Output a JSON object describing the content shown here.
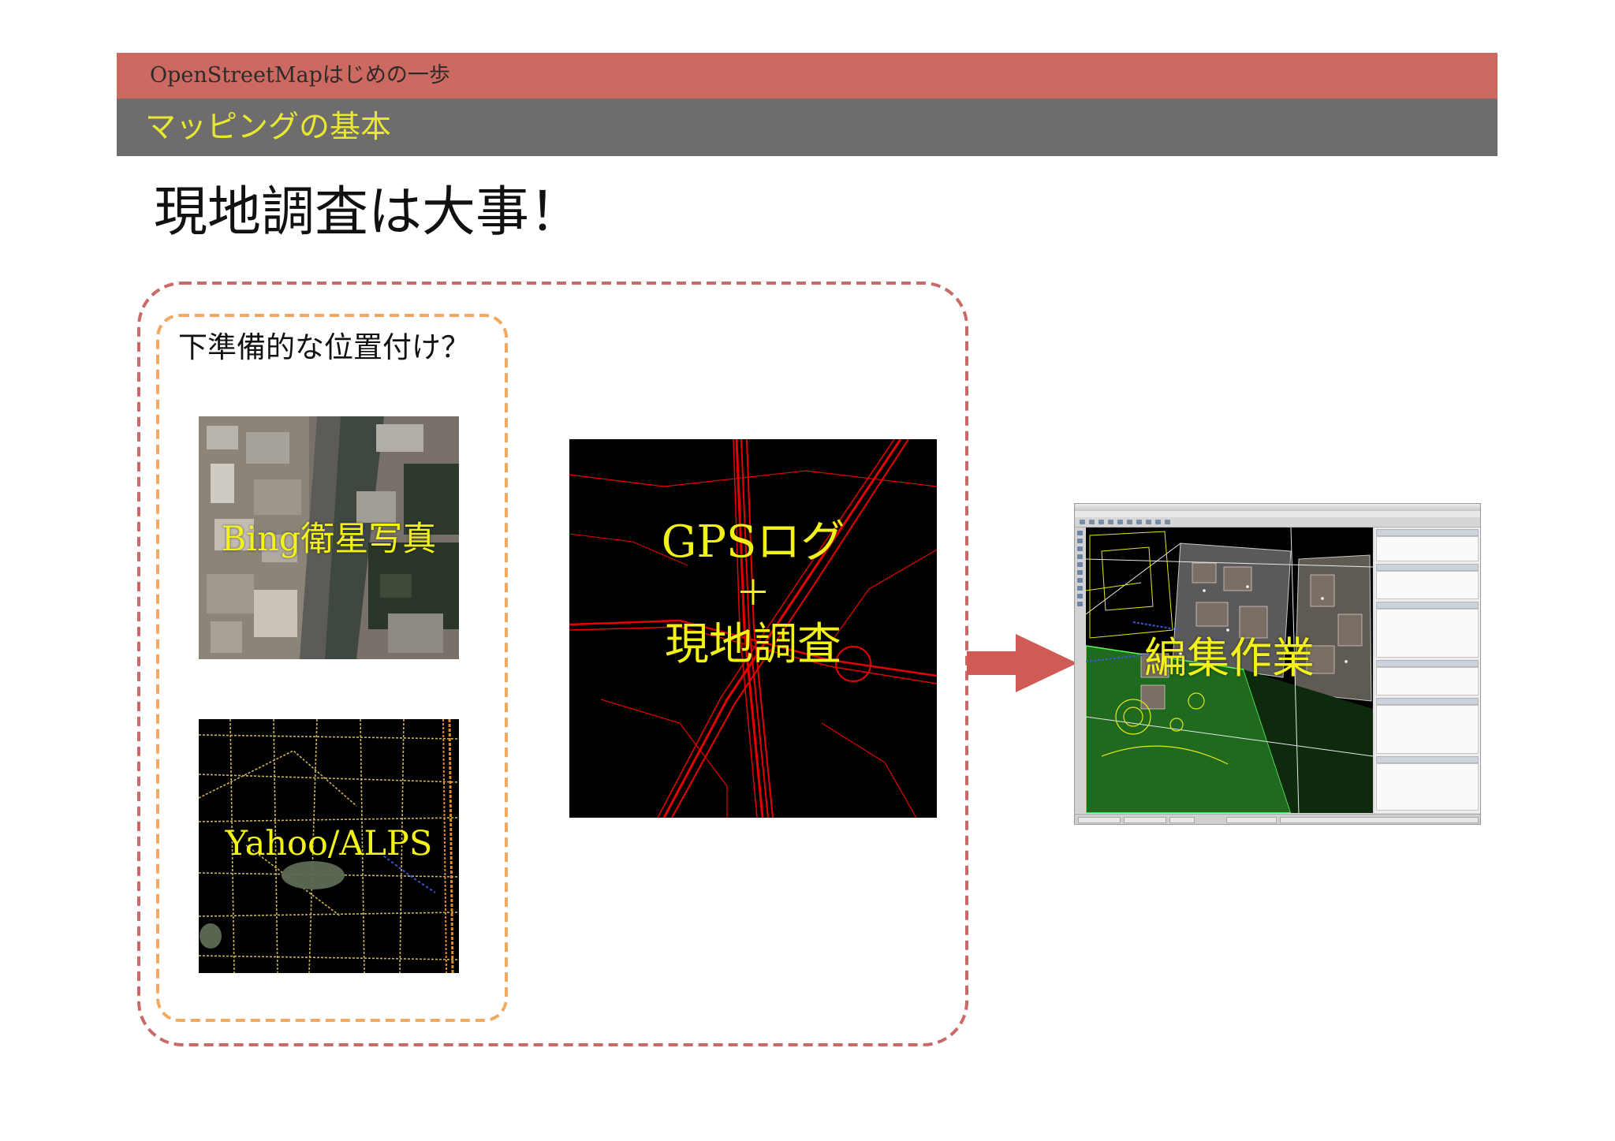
{
  "header": {
    "series_title": "OpenStreetMapはじめの一歩",
    "section_title": "マッピングの基本"
  },
  "slide": {
    "title": "現地調査は大事！"
  },
  "preparation_group": {
    "label": "下準備的な位置付け？",
    "bing_caption": "Bing衛星写真",
    "yahoo_caption": "Yahoo/ALPS"
  },
  "gps_panel": {
    "caption_line1": "GPSログ",
    "caption_line2": "＋",
    "caption_line3": "現地調査"
  },
  "result": {
    "caption": "編集作業"
  },
  "colors": {
    "header_top": "#cc6a62",
    "header_sub": "#6e6c6c",
    "header_sub_text": "#e8e832",
    "outer_dashed_border": "#c0504d",
    "inner_dashed_border": "#f0a050",
    "caption_yellow": "#f2f218",
    "gps_track": "#e80000",
    "arrow": "#d05a54"
  },
  "icons": {
    "flow_arrow": "arrow-right-icon"
  }
}
